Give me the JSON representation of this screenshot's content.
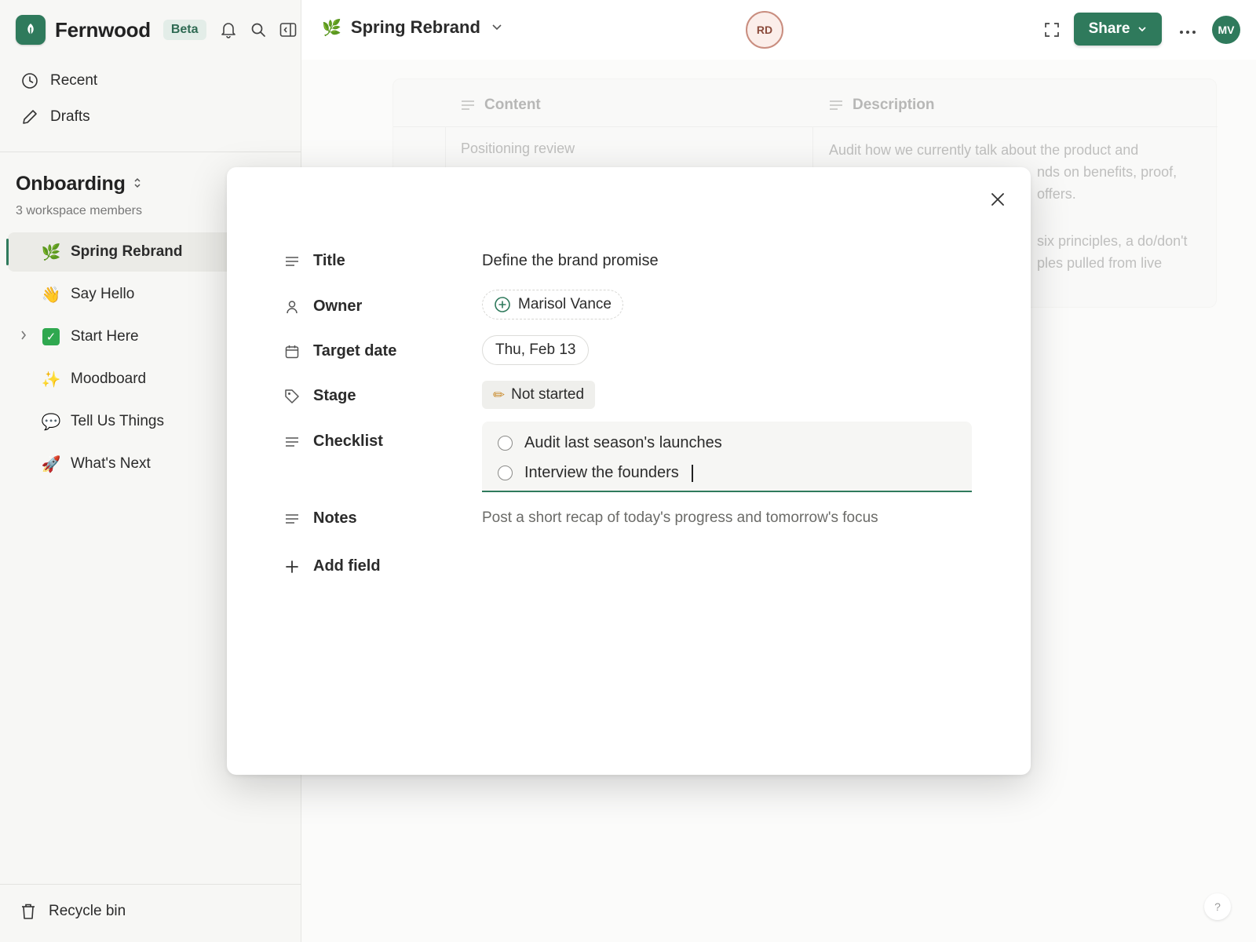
{
  "app": {
    "name": "Fernwood",
    "badge": "Beta"
  },
  "sidebar": {
    "nav": [
      {
        "label": "Recent",
        "icon": "clock-icon"
      },
      {
        "label": "Drafts",
        "icon": "pencil-icon"
      }
    ],
    "workspace": {
      "title": "Onboarding",
      "members": "3 workspace members"
    },
    "pages": [
      {
        "label": "Spring Rebrand",
        "emoji": "🌿",
        "active": true
      },
      {
        "label": "Say Hello",
        "emoji": "👋"
      },
      {
        "label": "Start Here",
        "emoji": "✓",
        "has_children": true
      },
      {
        "label": "Moodboard",
        "emoji": "✨"
      },
      {
        "label": "Tell Us Things",
        "emoji": "💬"
      },
      {
        "label": "What's Next",
        "emoji": "🚀"
      }
    ],
    "recycle_bin": "Recycle bin"
  },
  "header": {
    "doc_title": "Spring Rebrand",
    "doc_emoji": "🌿",
    "collaborator_initials": "RD",
    "share_label": "Share",
    "user_initials": "MV"
  },
  "background_table": {
    "columns": [
      "Content",
      "Description"
    ],
    "row": {
      "content": "Positioning review",
      "description_lines": [
        "Audit how we currently talk about the product and",
        "nds on benefits, proof,",
        "offers.",
        "six principles, a do/don't",
        "ples pulled from live"
      ]
    }
  },
  "modal": {
    "fields": {
      "title_label": "Title",
      "title_value": "Define the brand promise",
      "owner_label": "Owner",
      "owner_value": "Marisol Vance",
      "date_label": "Target date",
      "date_value": "Thu, Feb 13",
      "stage_label": "Stage",
      "stage_value": "Not started",
      "stage_emoji": "✏",
      "checklist_label": "Checklist",
      "checklist_items": [
        "Audit last season's launches",
        "Interview the founders"
      ],
      "notes_label": "Notes",
      "notes_placeholder": "Post a short recap of today's progress and tomorrow's focus",
      "add_field_label": "Add field"
    }
  },
  "help_label": "?",
  "colors": {
    "accent": "#2f7a5c",
    "sidebar_bg": "#f7f7f5",
    "collaborator_ring": "#c98d7f"
  }
}
